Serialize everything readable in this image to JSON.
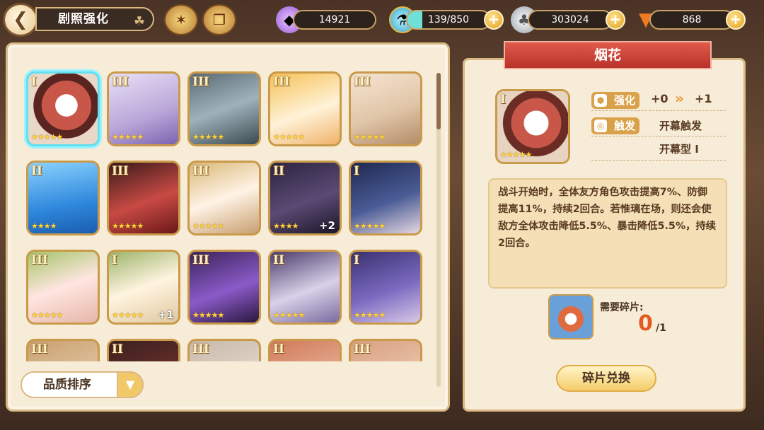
{
  "header": {
    "back_icon": "back-arrow-icon",
    "title": "剧照强化",
    "resources": [
      {
        "name": "crystal",
        "value": "14921",
        "icon": "crystal-icon"
      },
      {
        "name": "stamina",
        "value": "139/850",
        "icon": "potion-icon"
      },
      {
        "name": "coins",
        "value": "303024",
        "icon": "coin-icon"
      },
      {
        "name": "carrot",
        "value": "868",
        "icon": "carrot-icon"
      }
    ],
    "plus_symbol": "+"
  },
  "cards": [
    {
      "rank": "I",
      "stars": "★★★★★",
      "plus": "",
      "art": "fireworks"
    },
    {
      "rank": "III",
      "stars": "★★★★★",
      "plus": "",
      "art": "white-hair-girl"
    },
    {
      "rank": "III",
      "stars": "★★★★★",
      "plus": "",
      "art": "dark-hair-hat"
    },
    {
      "rank": "III",
      "stars": "★★★★★",
      "plus": "",
      "art": "witch-hat-bunny"
    },
    {
      "rank": "III",
      "stars": "★★★★★",
      "plus": "",
      "art": "beige-hair-girl"
    },
    {
      "rank": "II",
      "stars": "★★★★",
      "plus": "",
      "art": "blue-sky"
    },
    {
      "rank": "III",
      "stars": "★★★★★",
      "plus": "",
      "art": "red-skin-girl"
    },
    {
      "rank": "III",
      "stars": "★★★★★",
      "plus": "",
      "art": "bunny-ears-girl"
    },
    {
      "rank": "II",
      "stars": "★★★★",
      "plus": "+2",
      "art": "dark-long-hair"
    },
    {
      "rank": "I",
      "stars": "★★★★★",
      "plus": "",
      "art": "navy-hair-elf"
    },
    {
      "rank": "III",
      "stars": "★★★★★",
      "plus": "",
      "art": "peach-hair-girl"
    },
    {
      "rank": "I",
      "stars": "★★★★★",
      "plus": "+1",
      "art": "cream-hair-girl"
    },
    {
      "rank": "III",
      "stars": "★★★★★",
      "plus": "",
      "art": "purple-wings"
    },
    {
      "rank": "II",
      "stars": "★★★★★",
      "plus": "",
      "art": "silver-crown"
    },
    {
      "rank": "I",
      "stars": "★★★★★",
      "plus": "",
      "art": "purple-tentacle"
    },
    {
      "rank": "III",
      "stars": "",
      "plus": "",
      "art": "partial-1"
    },
    {
      "rank": "II",
      "stars": "",
      "plus": "",
      "art": "partial-2"
    },
    {
      "rank": "III",
      "stars": "",
      "plus": "",
      "art": "partial-3"
    },
    {
      "rank": "II",
      "stars": "",
      "plus": "",
      "art": "partial-4"
    },
    {
      "rank": "III",
      "stars": "",
      "plus": "",
      "art": "partial-5"
    }
  ],
  "sort": {
    "label": "品质排序",
    "arrow_icon": "chevron-down-icon"
  },
  "detail": {
    "name": "烟花",
    "rank": "I",
    "stars": "★★★★★",
    "enhance_label": "强化",
    "enhance_from": "+0",
    "enhance_arrow": "»",
    "enhance_to": "+1",
    "trigger_label": "触发",
    "trigger_value": "开幕触发",
    "type_value": "开幕型 I",
    "description": "战斗开始时，全体友方角色攻击提高7%、防御提高11%，持续2回合。若惟璃在场，则还会使敌方全体攻击降低5.5%、暴击降低5.5%，持续2回合。",
    "need_label": "需要碎片:",
    "fragment_count": "0",
    "fragment_total": "/1",
    "exchange_label": "碎片兑换"
  },
  "colors": {
    "panel_bg": "#f7ecd8",
    "accent_gold": "#d9a24a",
    "banner_red": "#c8392f",
    "selected_cyan": "#60e0f0"
  }
}
